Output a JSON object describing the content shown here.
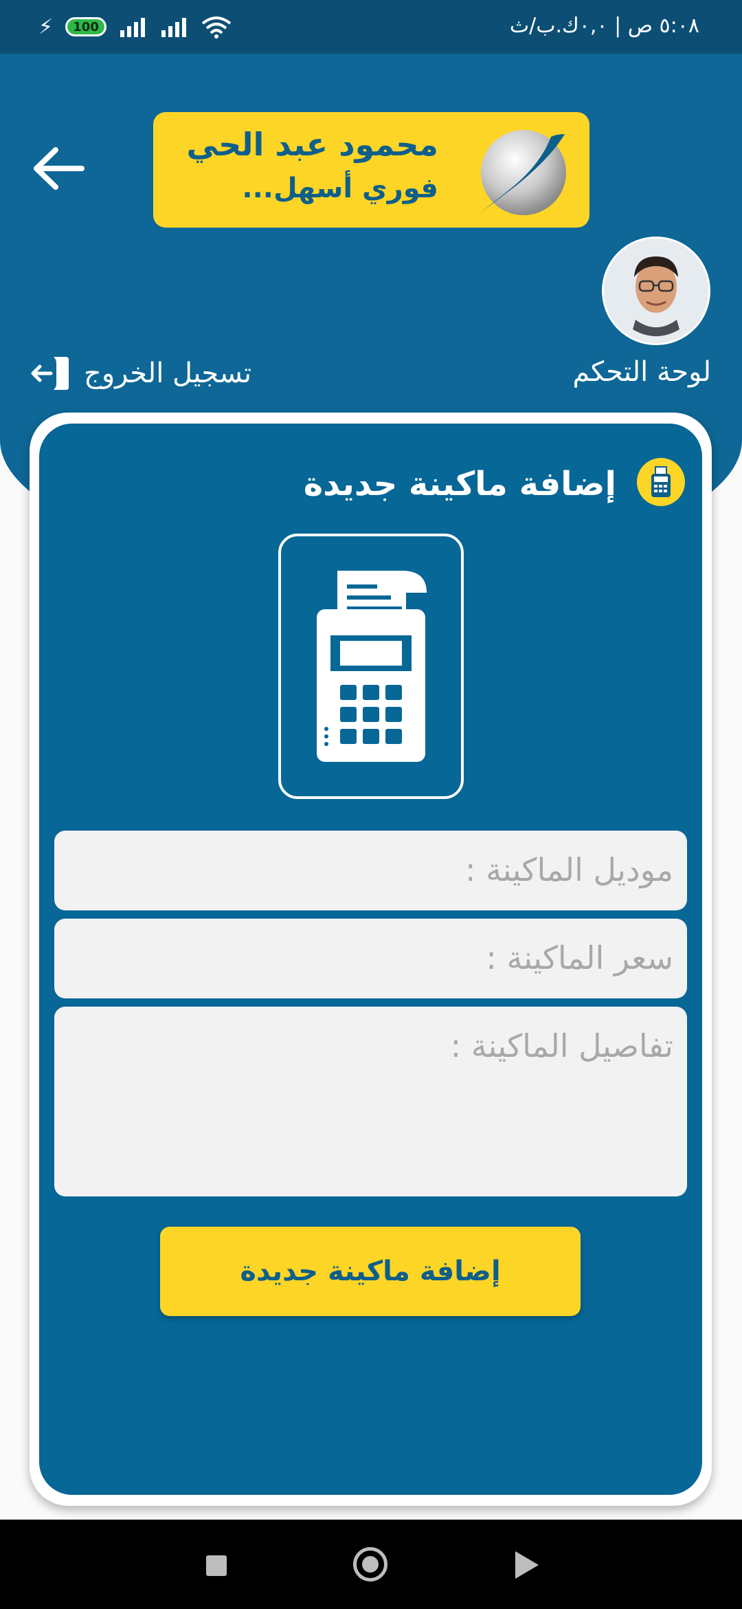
{
  "status_bar": {
    "battery": "100",
    "time": "٥:٠٨ ص | ٠,٠ك.ب/ث"
  },
  "logo": {
    "name": "محمود عبد الحي",
    "slogan": "فوري أسهل..."
  },
  "header": {
    "dashboard_label": "لوحة التحكم",
    "logout_label": "تسجيل الخروج"
  },
  "card": {
    "title": "إضافة ماكينة جديدة",
    "fields": {
      "model_placeholder": "موديل الماكينة :",
      "price_placeholder": "سعر الماكينة :",
      "details_placeholder": "تفاصيل الماكينة :"
    },
    "submit_label": "إضافة ماكينة جديدة"
  },
  "icons": {
    "back": "arrow-left-icon",
    "logout": "logout-door-icon",
    "title": "pos-machine-icon",
    "machine": "pos-machine-icon"
  },
  "colors": {
    "primary": "#0e6796",
    "accent": "#fdd526",
    "field_bg": "#f2f2f2"
  }
}
